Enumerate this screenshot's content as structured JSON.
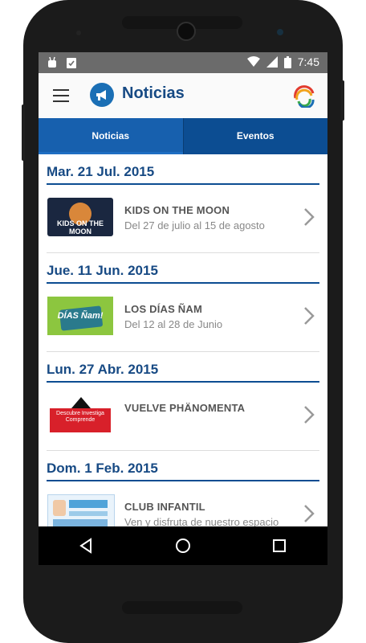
{
  "status": {
    "time": "7:45"
  },
  "appbar": {
    "title": "Noticias"
  },
  "tabs": [
    {
      "label": "Noticias",
      "active": true
    },
    {
      "label": "Eventos",
      "active": false
    }
  ],
  "sections": [
    {
      "date": "Mar. 21 Jul. 2015",
      "item": {
        "title": "KIDS ON THE MOON",
        "subtitle": "Del 27 de julio al 15 de agosto",
        "thumb_text": "KIDS ON THE MOON"
      }
    },
    {
      "date": "Jue. 11 Jun. 2015",
      "item": {
        "title": "LOS DÍAS ÑAM",
        "subtitle": "Del 12 al 28 de Junio",
        "thumb_text": "DÍAS Ñam!"
      }
    },
    {
      "date": "Lun. 27 Abr. 2015",
      "item": {
        "title": "VUELVE PHÄNOMENTA",
        "subtitle": "",
        "thumb_text": "Descubre Investiga Comprende"
      }
    },
    {
      "date": "Dom. 1 Feb. 2015",
      "item": {
        "title": "CLUB INFANTIL",
        "subtitle": "Ven y disfruta de nuestro espacio para los mas pequeños"
      }
    }
  ],
  "colors": {
    "primary": "#0c4d92",
    "tab_active": "#1760ae",
    "title_blue": "#174a84"
  },
  "icons": [
    "menu-icon",
    "megaphone-icon",
    "brand-logo-icon",
    "chevron-right-icon",
    "back-icon",
    "home-icon",
    "recents-icon",
    "wifi-icon",
    "signal-icon",
    "battery-icon"
  ]
}
